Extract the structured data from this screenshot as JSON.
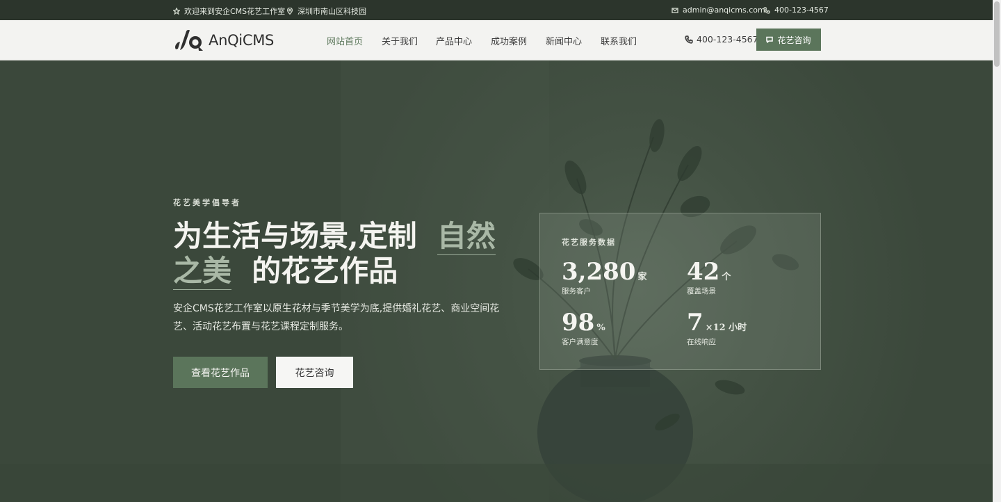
{
  "topbar": {
    "welcome": "欢迎来到安企CMS花艺工作室",
    "address": "深圳市南山区科技园",
    "email": "admin@anqicms.com",
    "phone": "400-123-4567"
  },
  "header": {
    "logo_text": "AnQiCMS",
    "nav": [
      {
        "label": "网站首页",
        "active": true
      },
      {
        "label": "关于我们",
        "active": false
      },
      {
        "label": "产品中心",
        "active": false
      },
      {
        "label": "成功案例",
        "active": false
      },
      {
        "label": "新闻中心",
        "active": false
      },
      {
        "label": "联系我们",
        "active": false
      }
    ],
    "phone": "400-123-4567",
    "consult_label": "花艺咨询"
  },
  "hero": {
    "eyebrow": "花艺美学倡导者",
    "title_part1": "为生活与场景,定制",
    "title_highlight": "自然之美",
    "title_part2": "的花艺作品",
    "description": "安企CMS花艺工作室以原生花材与季节美学为底,提供婚礼花艺、商业空间花艺、活动花艺布置与花艺课程定制服务。",
    "primary_button": "查看花艺作品",
    "secondary_button": "花艺咨询"
  },
  "stats": {
    "title": "花艺服务数据",
    "items": [
      {
        "value": "3,280",
        "unit": "家",
        "label": "服务客户"
      },
      {
        "value": "42",
        "unit": "个",
        "label": "覆盖场景"
      },
      {
        "value": "98",
        "unit": "%",
        "label": "客户满意度"
      },
      {
        "value": "7",
        "unit": "×12 小时",
        "label": "在线响应"
      }
    ]
  },
  "icons": {
    "welcome": "star-icon",
    "address": "location-pin-icon",
    "email": "mail-icon",
    "phone": "phone-icon",
    "consult": "chat-icon"
  },
  "colors": {
    "brand_green": "#5b755b",
    "topbar_bg": "#2c352c",
    "hero_bg": "#3e4b3e",
    "nav_active": "#5f7a5e"
  }
}
